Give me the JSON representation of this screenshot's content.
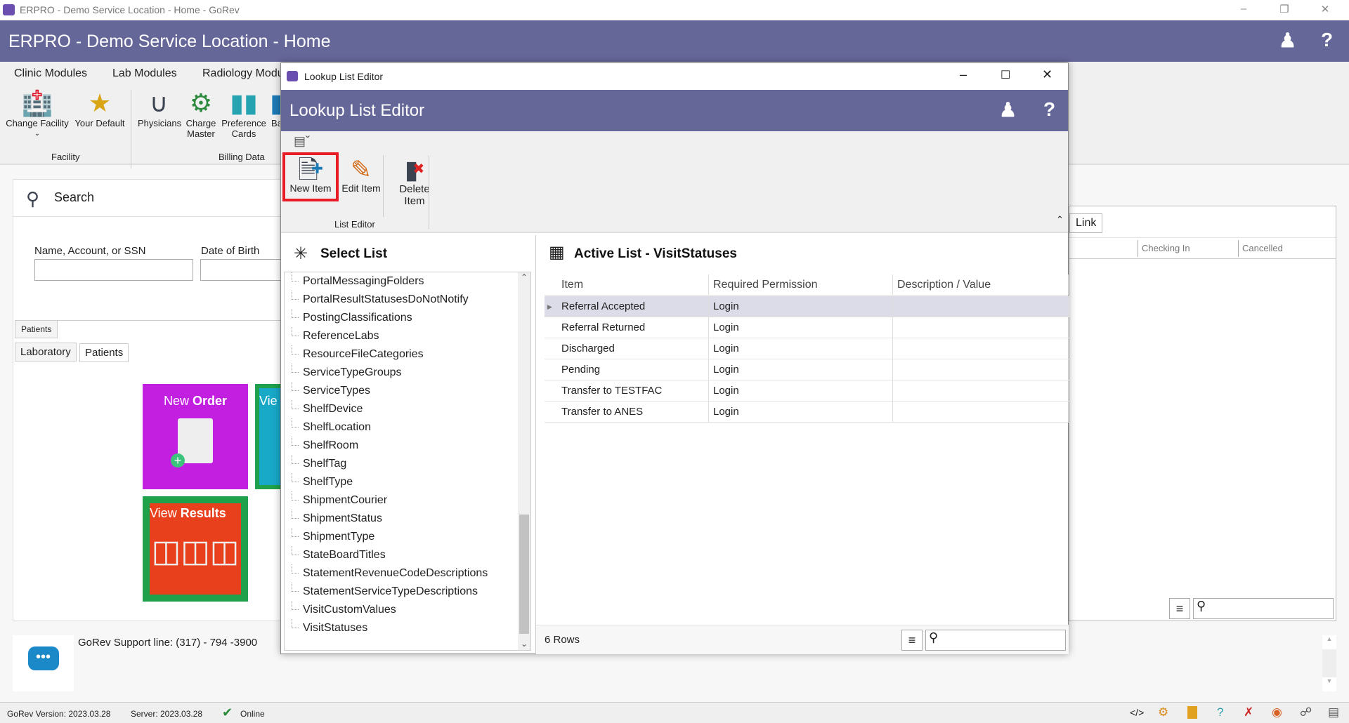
{
  "window": {
    "title": "ERPRO - Demo Service Location - Home - GoRev",
    "minimize": "–",
    "restore": "❐",
    "close": "✕"
  },
  "header": {
    "title": "ERPRO - Demo Service Location - Home",
    "help": "?"
  },
  "ribbon": {
    "tabs": [
      "Clinic Modules",
      "Lab Modules",
      "Radiology Modu"
    ],
    "buttons": [
      {
        "label": "Change Facility",
        "icon": "building-icon"
      },
      {
        "label": "Your Default",
        "icon": "star-icon"
      },
      {
        "label": "Physicians",
        "icon": "stethoscope-icon"
      },
      {
        "label": "Charge Master",
        "icon": "dollar-gear-icon"
      },
      {
        "label": "Preference Cards",
        "icon": "cards-icon"
      },
      {
        "label": "Ba",
        "icon": "bag-icon"
      }
    ],
    "groups": [
      "Facility",
      "Billing Data"
    ]
  },
  "search": {
    "title": "Search",
    "name_label": "Name, Account, or SSN",
    "dob_label": "Date of Birth",
    "name_value": "",
    "dob_value": "",
    "subtab": "Patients"
  },
  "module_tabs": [
    "Laboratory",
    "Patients"
  ],
  "tiles": [
    {
      "label_light": "New ",
      "label_bold": "Order",
      "color": "#c21fe0"
    },
    {
      "label_light": "Vie",
      "label_bold": "",
      "color": "#18a8c8"
    },
    {
      "label_light": "View ",
      "label_bold": "Results",
      "color": "#e8401c"
    }
  ],
  "support": {
    "text": "GoRev Support line: (317) - 794 -3900"
  },
  "background_grid": {
    "link_button": "Link",
    "columns": [
      "Checking In",
      "Cancelled"
    ]
  },
  "status": {
    "version": "GoRev Version: 2023.03.28",
    "server": "Server: 2023.03.28",
    "online": "Online"
  },
  "dialog": {
    "window_title": "Lookup List Editor",
    "header_title": "Lookup List Editor",
    "help": "?",
    "ribbon": {
      "buttons": [
        {
          "label": "New Item",
          "highlighted": true
        },
        {
          "label": "Edit Item"
        },
        {
          "label": "Delete Item"
        }
      ],
      "group": "List Editor"
    },
    "select_list": {
      "title": "Select List",
      "items": [
        "PortalMessagingFolders",
        "PortalResultStatusesDoNotNotify",
        "PostingClassifications",
        "ReferenceLabs",
        "ResourceFileCategories",
        "ServiceTypeGroups",
        "ServiceTypes",
        "ShelfDevice",
        "ShelfLocation",
        "ShelfRoom",
        "ShelfTag",
        "ShelfType",
        "ShipmentCourier",
        "ShipmentStatus",
        "ShipmentType",
        "StateBoardTitles",
        "StatementRevenueCodeDescriptions",
        "StatementServiceTypeDescriptions",
        "VisitCustomValues",
        "VisitStatuses"
      ]
    },
    "active_list": {
      "title": "Active List - VisitStatuses",
      "columns": [
        "Item",
        "Required Permission",
        "Description / Value"
      ],
      "rows": [
        [
          "Referral Accepted",
          "Login",
          ""
        ],
        [
          "Referral Returned",
          "Login",
          ""
        ],
        [
          "Discharged",
          "Login",
          ""
        ],
        [
          "Pending",
          "Login",
          ""
        ],
        [
          "Transfer to TESTFAC",
          "Login",
          ""
        ],
        [
          "Transfer to ANES",
          "Login",
          ""
        ]
      ],
      "selected_row": 0,
      "row_count": "6 Rows",
      "search_value": ""
    }
  },
  "colors": {
    "brand": "#666799",
    "highlight": "#e81c24"
  }
}
